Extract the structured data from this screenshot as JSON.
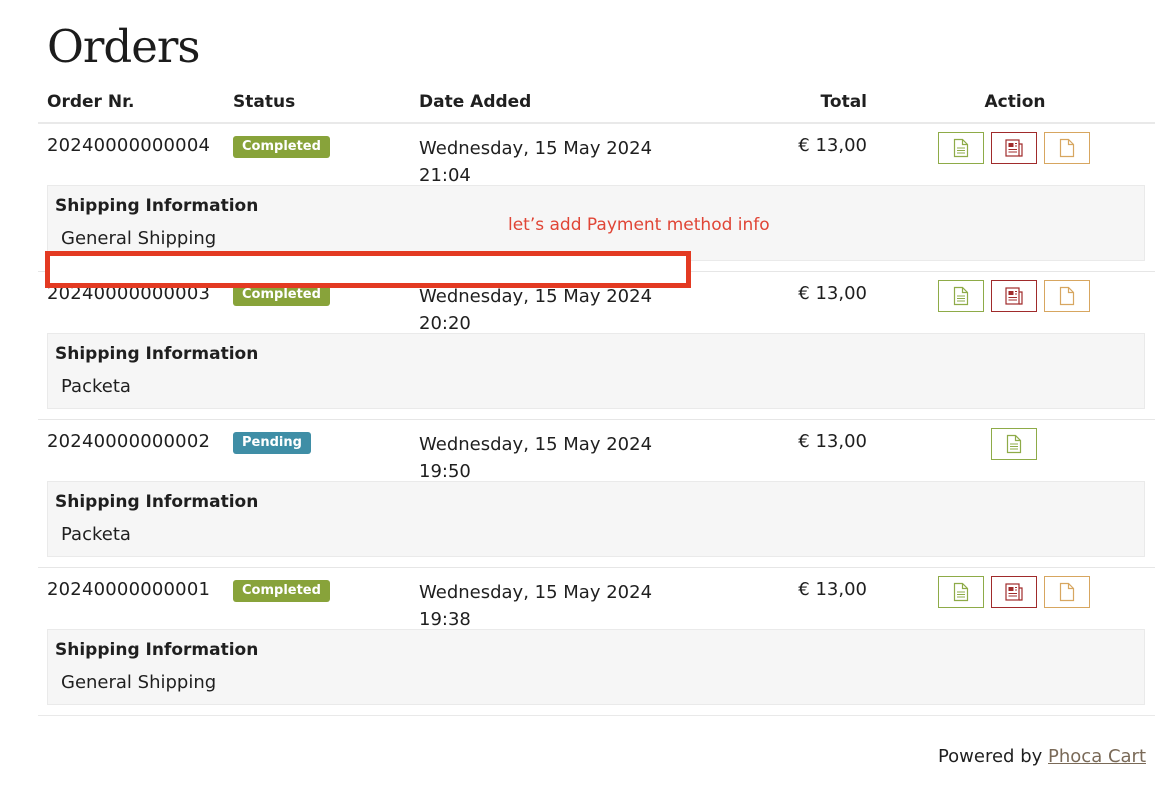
{
  "page": {
    "title": "Orders"
  },
  "table": {
    "headers": {
      "order": "Order Nr.",
      "status": "Status",
      "date": "Date Added",
      "total": "Total",
      "action": "Action"
    }
  },
  "orders": [
    {
      "number": "20240000000004",
      "status": "Completed",
      "date": "Wednesday, 15 May 2024",
      "time": "21:04",
      "total": "€ 13,00",
      "shipping_label": "Shipping Information",
      "shipping_method": "General Shipping"
    },
    {
      "number": "20240000000003",
      "status": "Completed",
      "date": "Wednesday, 15 May 2024",
      "time": "20:20",
      "total": "€ 13,00",
      "shipping_label": "Shipping Information",
      "shipping_method": "Packeta"
    },
    {
      "number": "20240000000002",
      "status": "Pending",
      "date": "Wednesday, 15 May 2024",
      "time": "19:50",
      "total": "€ 13,00",
      "shipping_label": "Shipping Information",
      "shipping_method": "Packeta"
    },
    {
      "number": "20240000000001",
      "status": "Completed",
      "date": "Wednesday, 15 May 2024",
      "time": "19:38",
      "total": "€ 13,00",
      "shipping_label": "Shipping Information",
      "shipping_method": "General Shipping"
    }
  ],
  "annotation": {
    "text": "let’s add Payment method info"
  },
  "footer": {
    "prefix": "Powered by",
    "link": "Phoca Cart"
  },
  "colors": {
    "status_completed": "#88a33a",
    "status_pending": "#3f8ea6",
    "invoice_button": "#8eab48",
    "receipt_button": "#a02b2b",
    "delivery_note_button": "#d7a660",
    "annotation": "#e33a22"
  },
  "icons": {
    "invoice": "document-icon",
    "receipt": "receipt-icon",
    "delivery_note": "blank-document-icon"
  }
}
